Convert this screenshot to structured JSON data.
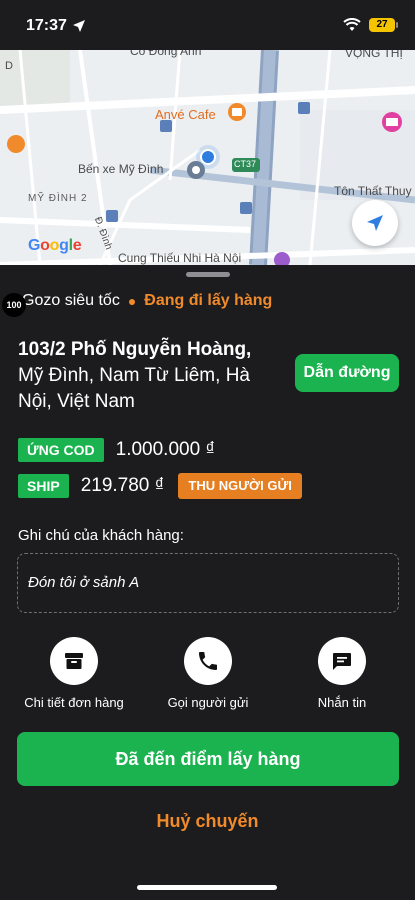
{
  "status_bar": {
    "time": "17:37",
    "battery": "27"
  },
  "map": {
    "labels": {
      "top_cut": "Cổ Đống Anh",
      "top_right_cut": "VỌNG THỊ",
      "anve_cafe": "Anvé Cafe",
      "bus_station": "Bến xe Mỹ Đình",
      "my_dinh_2": "MỸ ĐÌNH 2",
      "road_ct37": "CT37",
      "ton_that_thuyet": "Tôn Thất Thuy",
      "theater": "Cung Thiếu Nhi Hà Nội",
      "side_left": "D",
      "side_road": "Đ. Đình"
    },
    "logo_letters": [
      "G",
      "o",
      "o",
      "g",
      "l",
      "e"
    ]
  },
  "badge": "100",
  "service": {
    "name": "Gozo siêu tốc",
    "status": "Đang đi lấy hàng"
  },
  "address": {
    "line1": "103/2 Phố Nguyễn Hoàng,",
    "line2": "Mỹ Đình, Nam Từ Liêm, Hà Nội, Việt Nam"
  },
  "directions_label": "Dẫn đường",
  "payment": {
    "cod_tag": "ỨNG COD",
    "cod_value": "1.000.000 ₫",
    "ship_tag": "SHIP",
    "ship_value": "219.780 ₫",
    "collect_tag": "THU NGƯỜI GỬI"
  },
  "note": {
    "label": "Ghi chú của khách hàng:",
    "text": "Đón tôi ở sảnh A"
  },
  "actions": [
    {
      "label": "Chi tiết đơn hàng",
      "icon": "archive-box-icon"
    },
    {
      "label": "Gọi người gửi",
      "icon": "phone-icon"
    },
    {
      "label": "Nhắn tin",
      "icon": "chat-icon"
    }
  ],
  "primary_button": "Đã đến điểm lấy hàng",
  "cancel_button": "Huỷ chuyến",
  "colors": {
    "green": "#1ab34f",
    "orange": "#f08a2a",
    "background": "#1c1c1e"
  }
}
